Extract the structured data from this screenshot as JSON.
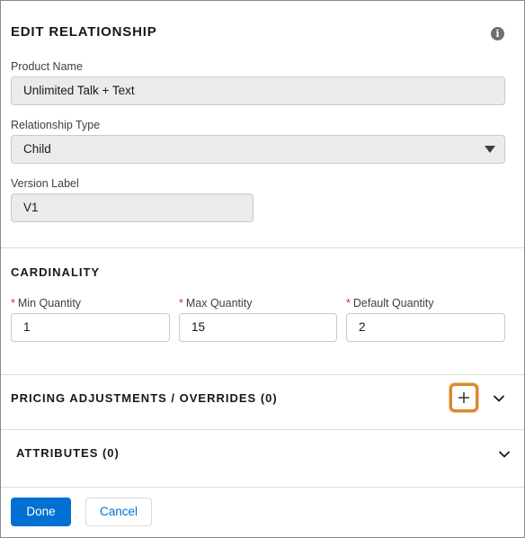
{
  "dialog": {
    "title": "EDIT RELATIONSHIP",
    "info_icon": "info-icon"
  },
  "fields": {
    "product_name": {
      "label": "Product Name",
      "value": "Unlimited Talk + Text"
    },
    "relationship_type": {
      "label": "Relationship Type",
      "value": "Child"
    },
    "version_label": {
      "label": "Version Label",
      "value": "V1"
    }
  },
  "cardinality": {
    "title": "CARDINALITY",
    "required_marker": "*",
    "min": {
      "label": "Min Quantity",
      "value": "1"
    },
    "max": {
      "label": "Max Quantity",
      "value": "15"
    },
    "default": {
      "label": "Default Quantity",
      "value": "2"
    }
  },
  "pricing": {
    "title": "PRICING ADJUSTMENTS / OVERRIDES (0)",
    "add_icon": "plus-icon",
    "toggle_icon": "chevron-down-icon"
  },
  "attributes": {
    "title": "ATTRIBUTES (0)",
    "toggle_icon": "chevron-down-icon"
  },
  "footer": {
    "done_label": "Done",
    "cancel_label": "Cancel"
  },
  "colors": {
    "brand_blue": "#0070d2",
    "focus_highlight": "#d8892a",
    "required_red": "#c23934",
    "readonly_bg": "#ecebea"
  }
}
